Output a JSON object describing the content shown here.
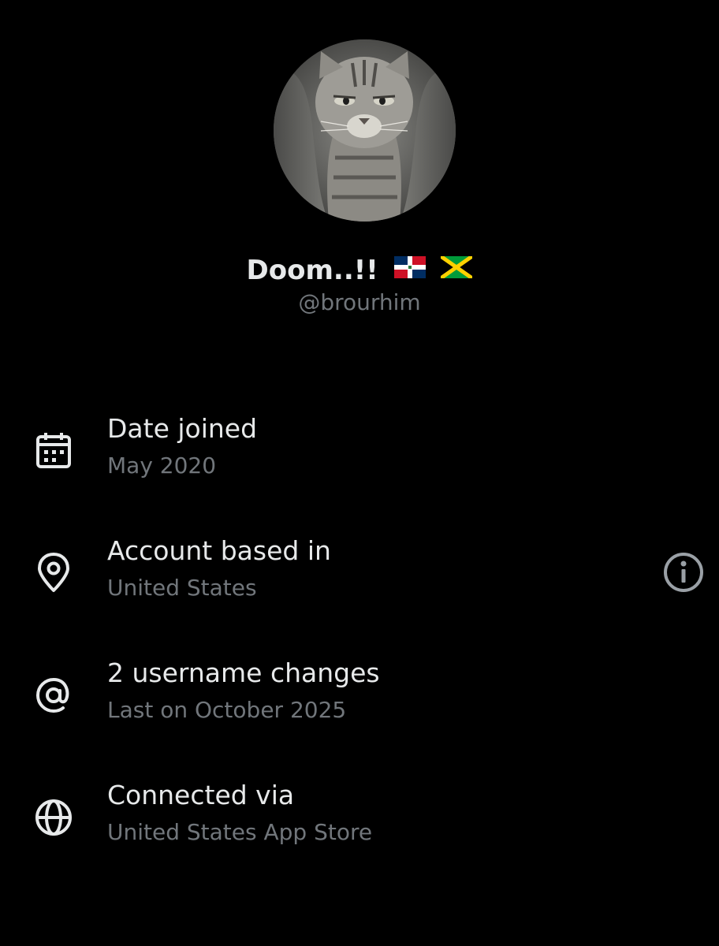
{
  "profile": {
    "display_name": "Doom..!!",
    "handle": "@brourhim",
    "avatar_icon": "cat-avatar",
    "flags": [
      "dominican-republic-flag-icon",
      "jamaica-flag-icon"
    ]
  },
  "details": [
    {
      "icon": "calendar-icon",
      "title": "Date joined",
      "subtitle": "May 2020"
    },
    {
      "icon": "location-pin-icon",
      "title": "Account based in",
      "subtitle": "United States",
      "action_icon": "info-icon"
    },
    {
      "icon": "at-sign-icon",
      "title": "2 username changes",
      "subtitle": "Last on October 2025"
    },
    {
      "icon": "globe-icon",
      "title": "Connected via",
      "subtitle": "United States App Store"
    }
  ],
  "colors": {
    "background": "#000000",
    "primary_text": "#e7e9ea",
    "secondary_text": "#71767b",
    "info_icon": "#9aa0a6"
  }
}
